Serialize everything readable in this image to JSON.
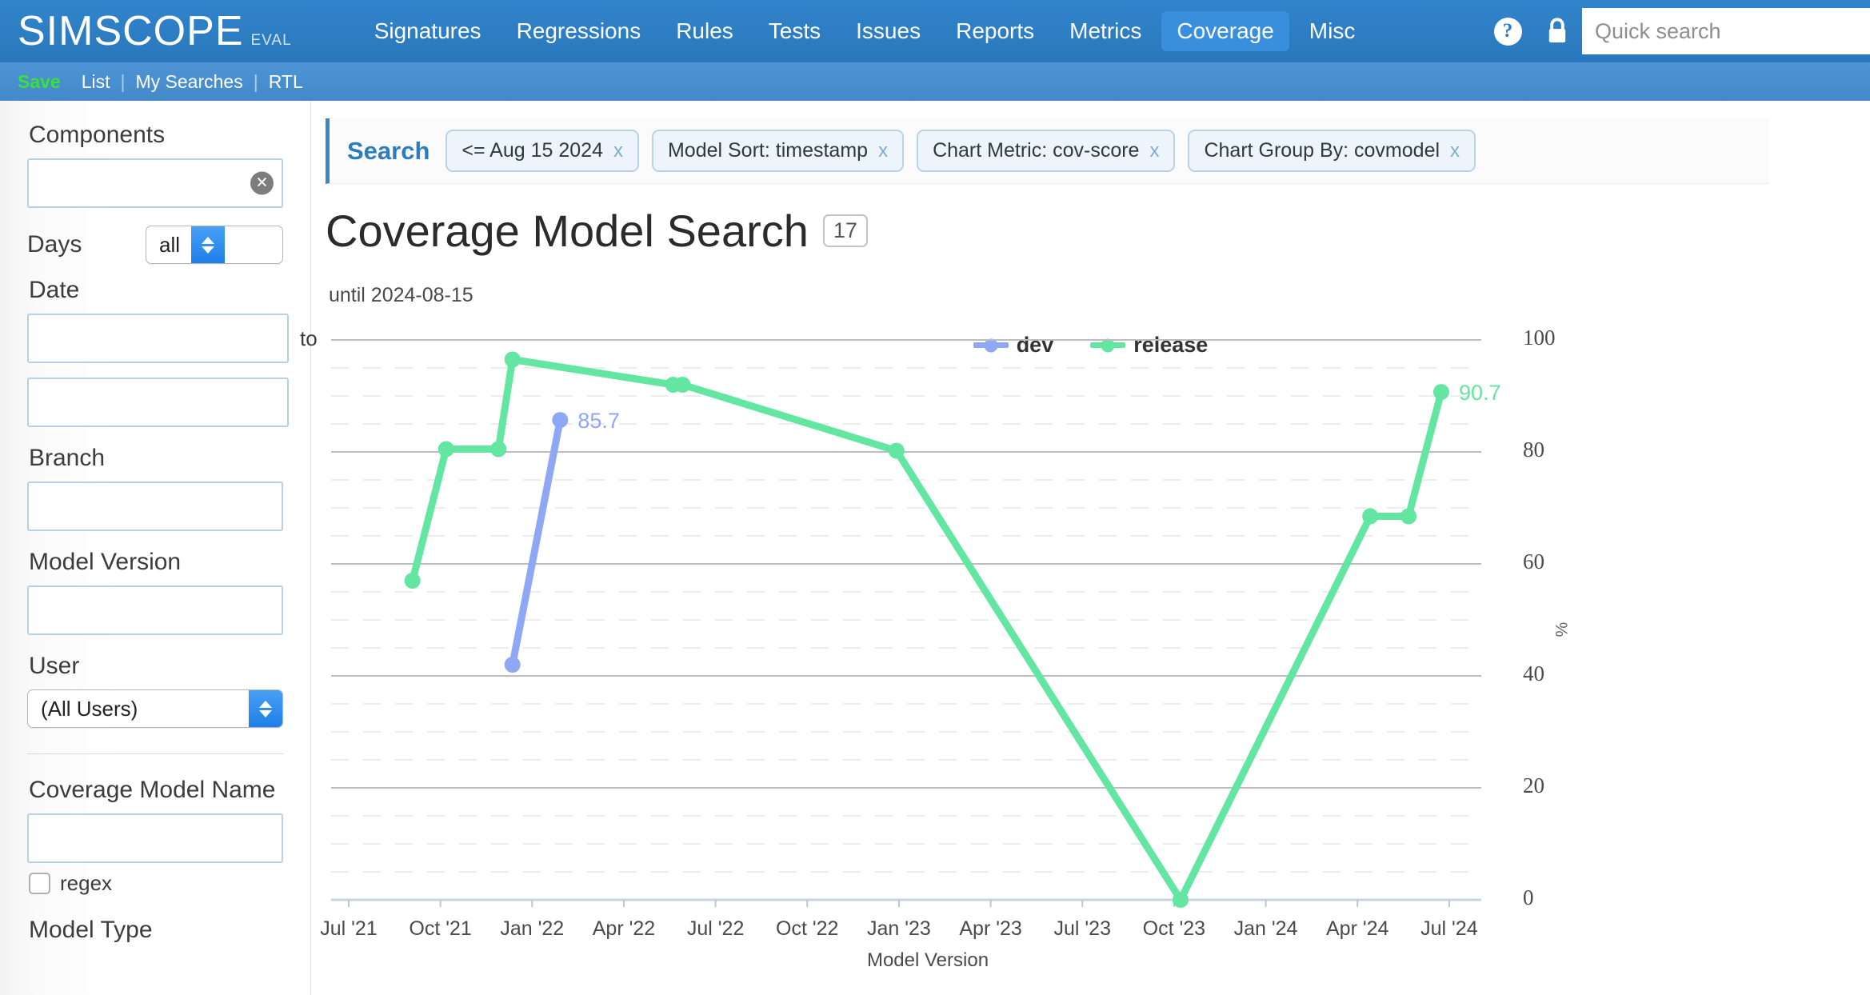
{
  "brand": {
    "name": "SIMSCOPE",
    "suffix": "EVAL"
  },
  "topnav": {
    "items": [
      {
        "label": "Signatures",
        "active": false
      },
      {
        "label": "Regressions",
        "active": false
      },
      {
        "label": "Rules",
        "active": false
      },
      {
        "label": "Tests",
        "active": false
      },
      {
        "label": "Issues",
        "active": false
      },
      {
        "label": "Reports",
        "active": false
      },
      {
        "label": "Metrics",
        "active": false
      },
      {
        "label": "Coverage",
        "active": true
      },
      {
        "label": "Misc",
        "active": false
      }
    ],
    "help_icon": "question-mark-icon",
    "lock_icon": "lock-icon",
    "quick_search_placeholder": "Quick search",
    "quick_search_value": ""
  },
  "subnav": {
    "save": "Save",
    "list": "List",
    "my_searches": "My Searches",
    "rtl": "RTL",
    "separator": "|"
  },
  "sidebar": {
    "components_label": "Components",
    "components_value": "",
    "components_clear_icon": "clear-circle-icon",
    "days_label": "Days",
    "days_value": "all",
    "date_label": "Date",
    "date_from_value": "",
    "date_to_value": "",
    "date_to_word": "to",
    "branch_label": "Branch",
    "branch_value": "",
    "model_version_label": "Model Version",
    "model_version_value": "",
    "user_label": "User",
    "user_value": "(All Users)",
    "coverage_model_name_label": "Coverage Model Name",
    "coverage_model_name_value": "",
    "regex_label": "regex",
    "regex_checked": false,
    "model_type_label": "Model Type"
  },
  "search": {
    "label": "Search",
    "chips": [
      {
        "text": "<= Aug 15 2024",
        "remove": "x"
      },
      {
        "text": "Model Sort:  timestamp",
        "remove": "x"
      },
      {
        "text": "Chart Metric:  cov-score",
        "remove": "x"
      },
      {
        "text": "Chart Group By:  covmodel",
        "remove": "x"
      }
    ]
  },
  "page": {
    "title": "Coverage Model Search",
    "count": "17",
    "until": "until 2024-08-15"
  },
  "chart_data": {
    "type": "line",
    "title": "",
    "subtitle": "until 2024-08-15",
    "xlabel": "Model Version",
    "ylabel": "%",
    "ylim": [
      0,
      100
    ],
    "yticks": [
      0,
      20,
      40,
      60,
      80,
      100
    ],
    "ytick_labels": [
      "0",
      "20",
      "40",
      "60",
      "80",
      "100"
    ],
    "xticks": [
      "Jul '21",
      "Oct '21",
      "Jan '22",
      "Apr '22",
      "Jul '22",
      "Oct '22",
      "Jan '23",
      "Apr '23",
      "Jul '23",
      "Oct '23",
      "Jan '24",
      "Apr '24",
      "Jul '24"
    ],
    "grid": true,
    "legend_position": "top-center",
    "colors": {
      "dev": "#8FA8F5",
      "release": "#63E6A2"
    },
    "series": [
      {
        "name": "dev",
        "color": "#8FA8F5",
        "points": [
          {
            "x": "2021-10-20",
            "y": 42.0
          },
          {
            "x": "2021-12-10",
            "y": 85.7
          }
        ],
        "end_label": "85.7"
      },
      {
        "name": "release",
        "color": "#63E6A2",
        "points": [
          {
            "x": "2021-07-05",
            "y": 57.0
          },
          {
            "x": "2021-08-10",
            "y": 80.5
          },
          {
            "x": "2021-10-05",
            "y": 80.5
          },
          {
            "x": "2021-10-20",
            "y": 96.5
          },
          {
            "x": "2022-04-10",
            "y": 92.0
          },
          {
            "x": "2022-04-20",
            "y": 92.0
          },
          {
            "x": "2022-12-05",
            "y": 80.2
          },
          {
            "x": "2023-10-05",
            "y": 0.0
          },
          {
            "x": "2024-04-25",
            "y": 68.5
          },
          {
            "x": "2024-06-05",
            "y": 68.5
          },
          {
            "x": "2024-07-10",
            "y": 90.7
          }
        ],
        "end_label": "90.7"
      }
    ]
  }
}
